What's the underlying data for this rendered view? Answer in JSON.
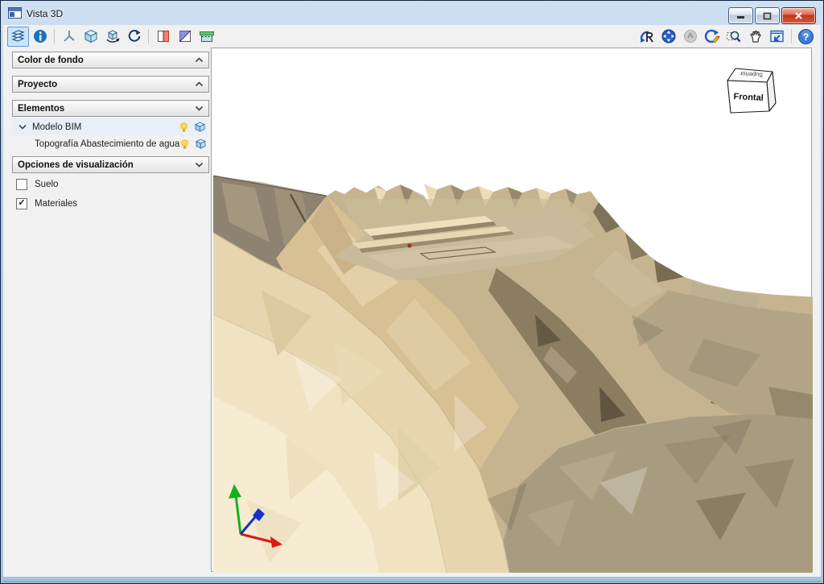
{
  "window": {
    "title": "Vista 3D",
    "controls": [
      {
        "name": "minimize"
      },
      {
        "name": "maximize"
      },
      {
        "name": "close"
      }
    ]
  },
  "toolbar": {
    "left_icons": [
      "layers",
      "info",
      "axes-tripod",
      "cube-3d",
      "orbit-cube",
      "rotate-view"
    ],
    "section_icons": [
      "section-plane-x",
      "section-plane-diagonal",
      "section-plane-top"
    ],
    "right_icons": [
      "previous-view",
      "zoom-extents",
      "zoom-selection-disabled",
      "redraw",
      "zoom-window",
      "pan-hand",
      "fit-window"
    ],
    "help_icon": "help",
    "selected_icon": "layers"
  },
  "sidebar": {
    "panels": [
      {
        "label": "Color de fondo",
        "state": "collapsed"
      },
      {
        "label": "Proyecto",
        "state": "collapsed"
      },
      {
        "label": "Elementos",
        "state": "expanded"
      },
      {
        "label": "Opciones de visualización",
        "state": "expanded"
      }
    ],
    "tree": [
      {
        "label": "Modelo BIM",
        "level": 0,
        "expanded": true,
        "visible": true,
        "selected": true
      },
      {
        "label": "Topografía Abastecimiento de agua",
        "level": 1,
        "visible": true,
        "selected": false
      }
    ],
    "checkboxes": [
      {
        "label": "Suelo",
        "checked": false,
        "glyph": ""
      },
      {
        "label": "Materiales",
        "checked": true,
        "glyph": "✓"
      }
    ]
  },
  "viewport": {
    "view_cube": {
      "front_label": "Frontal",
      "top_label": "Superior"
    },
    "axes": {
      "x_color": "#d91818",
      "y_color": "#1430cc",
      "z_color": "#14b01e"
    },
    "background_color": "#ffffff",
    "terrain_palette": [
      "#f6ecd2",
      "#f0e3c2",
      "#e6d5ae",
      "#d8c095",
      "#c6b491",
      "#b2a586",
      "#a89c80",
      "#8e8371",
      "#6c6149"
    ]
  }
}
